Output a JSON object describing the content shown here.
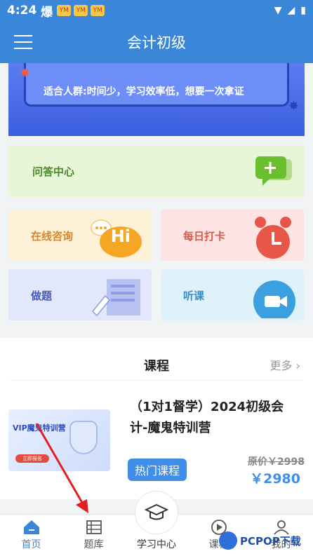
{
  "status_bar": {
    "time": "4:24",
    "flame": "爆",
    "notif": [
      "YM",
      "YM",
      "YM"
    ]
  },
  "header": {
    "title": "会计初级"
  },
  "banner": {
    "slogan": "适合人群:时间少，学习效率低，想要一次拿证"
  },
  "qa": {
    "label": "问答中心"
  },
  "tiles": {
    "consult": "在线咨询",
    "checkin": "每日打卡",
    "practice": "做题",
    "listen": "听课",
    "hi": "Hi"
  },
  "courses": {
    "title": "课程",
    "more": "更多",
    "item": {
      "name": "（1对1督学）2024初级会计-魔鬼特训营",
      "tag": "热门课程",
      "original_price": "原价￥2998",
      "price": "￥2980",
      "thumb_title": "VIP魔鬼特训营",
      "thumb_btn": "立即报名"
    }
  },
  "tabbar": {
    "home": "首页",
    "bank": "题库",
    "center": "学习中心",
    "course": "课程",
    "mine": "我的"
  },
  "watermark": {
    "text": "PCPOP下载"
  },
  "colors": {
    "primary": "#3a86d8",
    "accent": "#3f8ee8"
  }
}
